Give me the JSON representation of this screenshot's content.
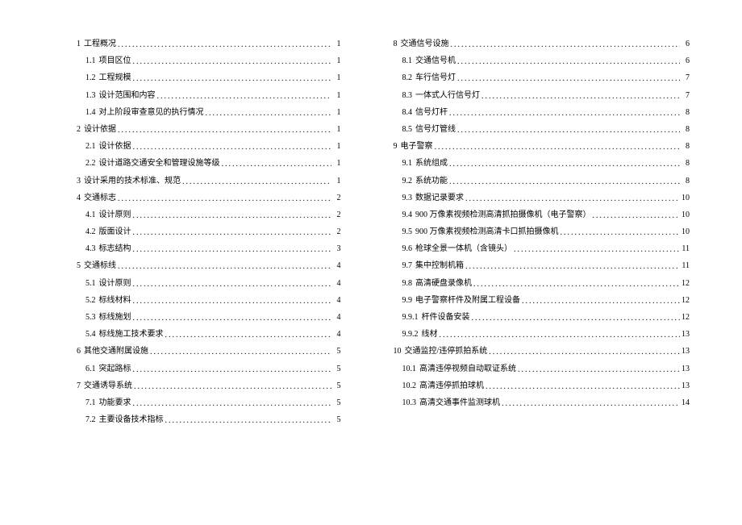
{
  "toc_left": [
    {
      "level": 1,
      "num": "1",
      "title": "工程概况",
      "page": "1"
    },
    {
      "level": 2,
      "num": "1.1",
      "title": "项目区位",
      "page": "1"
    },
    {
      "level": 2,
      "num": "1.2",
      "title": "工程规模",
      "page": "1"
    },
    {
      "level": 2,
      "num": "1.3",
      "title": "设计范围和内容",
      "page": "1"
    },
    {
      "level": 2,
      "num": "1.4",
      "title": "对上阶段审查意见的执行情况",
      "page": "1"
    },
    {
      "level": 1,
      "num": "2",
      "title": "设计依据",
      "page": "1"
    },
    {
      "level": 2,
      "num": "2.1",
      "title": "设计依据",
      "page": "1"
    },
    {
      "level": 2,
      "num": "2.2",
      "title": "设计道路交通安全和管理设施等级",
      "page": "1"
    },
    {
      "level": 1,
      "num": "3",
      "title": "设计采用的技术标准、规范",
      "page": "1"
    },
    {
      "level": 1,
      "num": "4",
      "title": "交通标志",
      "page": "2"
    },
    {
      "level": 2,
      "num": "4.1",
      "title": "设计原则",
      "page": "2"
    },
    {
      "level": 2,
      "num": "4.2",
      "title": "版面设计",
      "page": "2"
    },
    {
      "level": 2,
      "num": "4.3",
      "title": "标志结构",
      "page": "3"
    },
    {
      "level": 1,
      "num": "5",
      "title": "交通标线",
      "page": "4"
    },
    {
      "level": 2,
      "num": "5.1",
      "title": "设计原则",
      "page": "4"
    },
    {
      "level": 2,
      "num": "5.2",
      "title": "标线材料",
      "page": "4"
    },
    {
      "level": 2,
      "num": "5.3",
      "title": "标线施划",
      "page": "4"
    },
    {
      "level": 2,
      "num": "5.4",
      "title": "标线施工技术要求",
      "page": "4"
    },
    {
      "level": 1,
      "num": "6",
      "title": "其他交通附属设施",
      "page": "5"
    },
    {
      "level": 2,
      "num": "6.1",
      "title": "突起路标",
      "page": "5"
    },
    {
      "level": 1,
      "num": "7",
      "title": "交通诱导系统",
      "page": "5"
    },
    {
      "level": 2,
      "num": "7.1",
      "title": "功能要求",
      "page": "5"
    },
    {
      "level": 2,
      "num": "7.2",
      "title": "主要设备技术指标",
      "page": "5"
    }
  ],
  "toc_right": [
    {
      "level": 1,
      "num": "8",
      "title": "交通信号设施",
      "page": "6"
    },
    {
      "level": 2,
      "num": "8.1",
      "title": "交通信号机",
      "page": "6"
    },
    {
      "level": 2,
      "num": "8.2",
      "title": "车行信号灯",
      "page": "7"
    },
    {
      "level": 2,
      "num": "8.3",
      "title": "一体式人行信号灯",
      "page": "7"
    },
    {
      "level": 2,
      "num": "8.4",
      "title": "信号灯杆",
      "page": "8"
    },
    {
      "level": 2,
      "num": "8.5",
      "title": "信号灯管线",
      "page": "8"
    },
    {
      "level": 1,
      "num": "9",
      "title": "电子警察",
      "page": "8"
    },
    {
      "level": 2,
      "num": "9.1",
      "title": "系统组成",
      "page": "8"
    },
    {
      "level": 2,
      "num": "9.2",
      "title": "系统功能",
      "page": "8"
    },
    {
      "level": 2,
      "num": "9.3",
      "title": "数据记录要求",
      "page": "10"
    },
    {
      "level": 2,
      "num": "9.4",
      "title": "900 万像素视频检测高清抓拍摄像机（电子警察）",
      "page": "10"
    },
    {
      "level": 2,
      "num": "9.5",
      "title": "900 万像素视频检测高清卡口抓拍摄像机",
      "page": "10"
    },
    {
      "level": 2,
      "num": "9.6",
      "title": "枪球全景一体机（含镜头）",
      "page": "11"
    },
    {
      "level": 2,
      "num": "9.7",
      "title": "集中控制机箱",
      "page": "11"
    },
    {
      "level": 2,
      "num": "9.8",
      "title": "高清硬盘录像机",
      "page": "12"
    },
    {
      "level": 2,
      "num": "9.9",
      "title": "电子警察杆件及附属工程设备",
      "page": "12"
    },
    {
      "level": 3,
      "num": "9.9.1",
      "title": "杆件设备安装",
      "page": "12"
    },
    {
      "level": 3,
      "num": "9.9.2",
      "title": "线材",
      "page": "13"
    },
    {
      "level": 1,
      "num": "10",
      "title": "交通监控/违停抓拍系统",
      "page": "13"
    },
    {
      "level": 2,
      "num": "10.1",
      "title": "高清违停视频自动取证系统",
      "page": "13"
    },
    {
      "level": 2,
      "num": "10.2",
      "title": "高清违停抓拍球机",
      "page": "13"
    },
    {
      "level": 2,
      "num": "10.3",
      "title": "高清交通事件监测球机",
      "page": "14"
    }
  ]
}
